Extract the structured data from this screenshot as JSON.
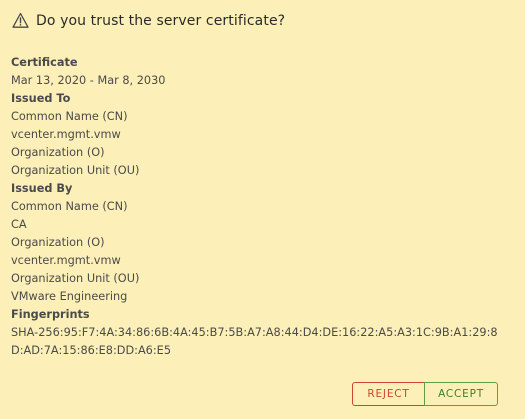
{
  "dialog": {
    "title": "Do you trust the server certificate?",
    "icon": "warning-triangle-icon"
  },
  "certificate": {
    "heading": "Certificate",
    "validity": "Mar 13, 2020 - Mar 8, 2030",
    "issued_to": {
      "heading": "Issued To",
      "cn_label": "Common Name (CN)",
      "cn_value": "vcenter.mgmt.vmw",
      "o_label": "Organization (O)",
      "ou_label": "Organization Unit (OU)"
    },
    "issued_by": {
      "heading": "Issued By",
      "cn_label": "Common Name (CN)",
      "cn_value": "CA",
      "o_label": "Organization (O)",
      "o_value": "vcenter.mgmt.vmw",
      "ou_label": "Organization Unit (OU)",
      "ou_value": "VMware Engineering"
    },
    "fingerprints": {
      "heading": "Fingerprints",
      "sha256": "SHA-256:95:F7:4A:34:86:6B:4A:45:B7:5B:A7:A8:44:D4:DE:16:22:A5:A3:1C:9B:A1:29:8D:AD:7A:15:86:E8:DD:A6:E5"
    }
  },
  "actions": {
    "reject_label": "REJECT",
    "accept_label": "ACCEPT"
  },
  "colors": {
    "background": "#fcf0b8",
    "reject": "#c9482e",
    "accept": "#5ea13b"
  }
}
